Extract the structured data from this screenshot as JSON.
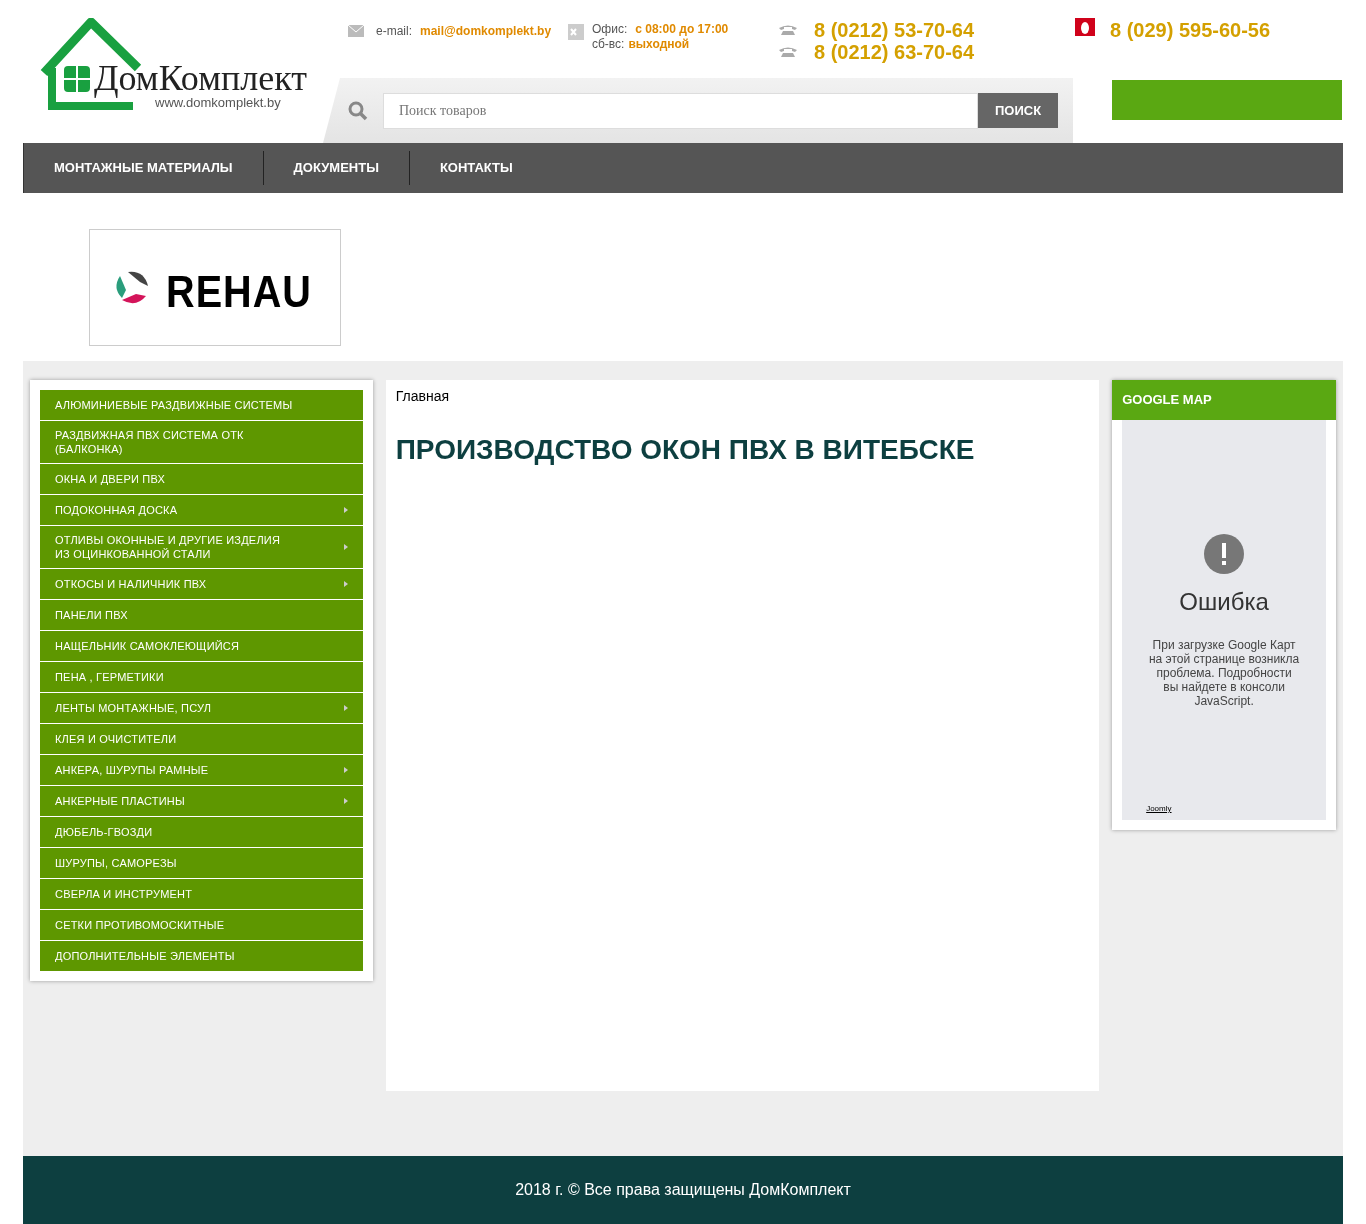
{
  "logo": {
    "name": "ДомКомплект",
    "url": "www.domkomplekt.by"
  },
  "contacts": {
    "email_label": "e-mail:",
    "email": "mail@domkomplekt.by",
    "office_label": "Офис:",
    "office_hours": "с 08:00 до 17:00",
    "weekend_label": "сб-вс:",
    "weekend_hours": "выходной",
    "phones": [
      "8 (0212) 53-70-64",
      "8 (0212) 63-70-64"
    ],
    "mobile": "8 (029) 595-60-56"
  },
  "search": {
    "placeholder": "Поиск товаров",
    "button": "ПОИСК"
  },
  "nav": [
    "МОНТАЖНЫЕ МАТЕРИАЛЫ",
    "ДОКУМЕНТЫ",
    "КОНТАКТЫ"
  ],
  "brand_banner": {
    "text": "REHAU"
  },
  "sidebar": {
    "items": [
      {
        "label": "АЛЮМИНИЕВЫЕ РАЗДВИЖНЫЕ СИСТЕМЫ",
        "has_submenu": false
      },
      {
        "label": "РАЗДВИЖНАЯ ПВХ СИСТЕМА ОТК (БАЛКОНКА)",
        "has_submenu": false
      },
      {
        "label": "ОКНА И ДВЕРИ ПВХ",
        "has_submenu": false
      },
      {
        "label": "ПОДОКОННАЯ ДОСКА",
        "has_submenu": true
      },
      {
        "label": "ОТЛИВЫ ОКОННЫЕ И ДРУГИЕ ИЗДЕЛИЯ ИЗ ОЦИНКОВАННОЙ СТАЛИ",
        "has_submenu": true
      },
      {
        "label": "ОТКОСЫ И НАЛИЧНИК ПВХ",
        "has_submenu": true
      },
      {
        "label": "ПАНЕЛИ ПВХ",
        "has_submenu": false
      },
      {
        "label": "НАЩЕЛЬНИК САМОКЛЕЮЩИЙСЯ",
        "has_submenu": false
      },
      {
        "label": "ПЕНА , ГЕРМЕТИКИ",
        "has_submenu": false
      },
      {
        "label": "ЛЕНТЫ МОНТАЖНЫЕ, ПСУЛ",
        "has_submenu": true
      },
      {
        "label": "КЛЕЯ И ОЧИСТИТЕЛИ",
        "has_submenu": false
      },
      {
        "label": "АНКЕРА, ШУРУПЫ РАМНЫЕ",
        "has_submenu": true
      },
      {
        "label": "АНКЕРНЫЕ ПЛАСТИНЫ",
        "has_submenu": true
      },
      {
        "label": "ДЮБЕЛЬ-ГВОЗДИ",
        "has_submenu": false
      },
      {
        "label": "ШУРУПЫ, САМОРЕЗЫ",
        "has_submenu": false
      },
      {
        "label": "СВЕРЛА И ИНСТРУМЕНТ",
        "has_submenu": false
      },
      {
        "label": "СЕТКИ ПРОТИВОМОСКИТНЫЕ",
        "has_submenu": false
      },
      {
        "label": "ДОПОЛНИТЕЛЬНЫЕ ЭЛЕМЕНТЫ",
        "has_submenu": false
      }
    ]
  },
  "content": {
    "breadcrumb": "Главная",
    "title": "ПРОИЗВОДСТВО ОКОН ПВХ В ВИТЕБСКЕ"
  },
  "map_widget": {
    "title": "GOOGLE MAP",
    "error_title": "Ошибка",
    "error_text": "При загрузке Google Карт на этой странице возникла проблема. Подробности вы найдете в консоли JavaScript.",
    "credit": "Joomly"
  },
  "footer": "2018 г. © Все права защищены ДомКомплект"
}
